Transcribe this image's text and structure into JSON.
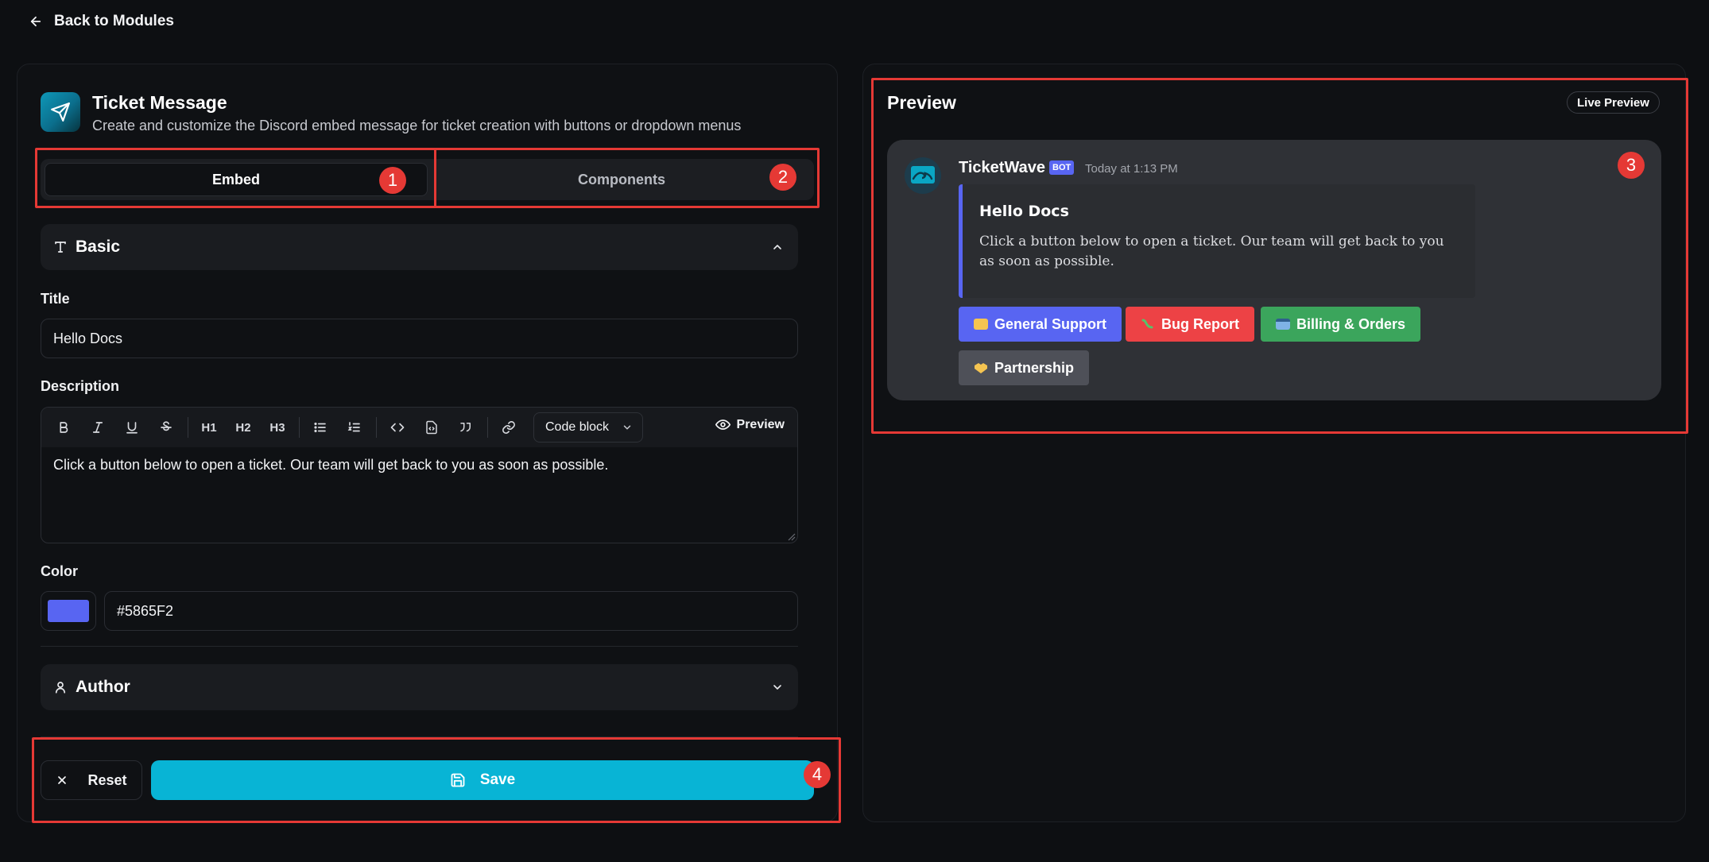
{
  "nav": {
    "back_label": "Back to Modules"
  },
  "module": {
    "title": "Ticket Message",
    "description": "Create and customize the Discord embed message for ticket creation with buttons or dropdown menus"
  },
  "tabs": [
    {
      "label": "Embed",
      "active": true
    },
    {
      "label": "Components",
      "active": false
    }
  ],
  "sections": {
    "basic": {
      "label": "Basic",
      "icon": "text-type-icon",
      "expanded": true
    },
    "author": {
      "label": "Author",
      "icon": "user-icon",
      "expanded": false
    }
  },
  "fields": {
    "title": {
      "label": "Title",
      "value": "Hello Docs"
    },
    "description": {
      "label": "Description",
      "value": "Click a button below to open a ticket. Our team will get back to you as soon as possible."
    },
    "color": {
      "label": "Color",
      "value": "#5865F2"
    }
  },
  "editor_toolbar": {
    "headings": [
      "H1",
      "H2",
      "H3"
    ],
    "block_select": "Code block",
    "preview_label": "Preview"
  },
  "actions": {
    "reset_label": "Reset",
    "save_label": "Save"
  },
  "preview": {
    "title": "Preview",
    "badge": "Live Preview",
    "bot_name": "TicketWave",
    "bot_tag": "BOT",
    "timestamp": "Today at 1:13 PM",
    "embed_title": "Hello Docs",
    "embed_description": "Click a button below to open a ticket. Our team will get back to you as soon as possible.",
    "embed_color": "#5865F2",
    "buttons": [
      {
        "label": "General Support",
        "color": "#5865F2",
        "emoji": "ticket"
      },
      {
        "label": "Bug Report",
        "color": "#ED4245",
        "emoji": "bug"
      },
      {
        "label": "Billing & Orders",
        "color": "#3BA55C",
        "emoji": "credit-card"
      },
      {
        "label": "Partnership",
        "color": "#4E5058",
        "emoji": "handshake"
      }
    ]
  },
  "annotations": [
    "1",
    "2",
    "3",
    "4"
  ],
  "colors": {
    "accent": "#08B4D5",
    "annotation": "#E53935"
  }
}
